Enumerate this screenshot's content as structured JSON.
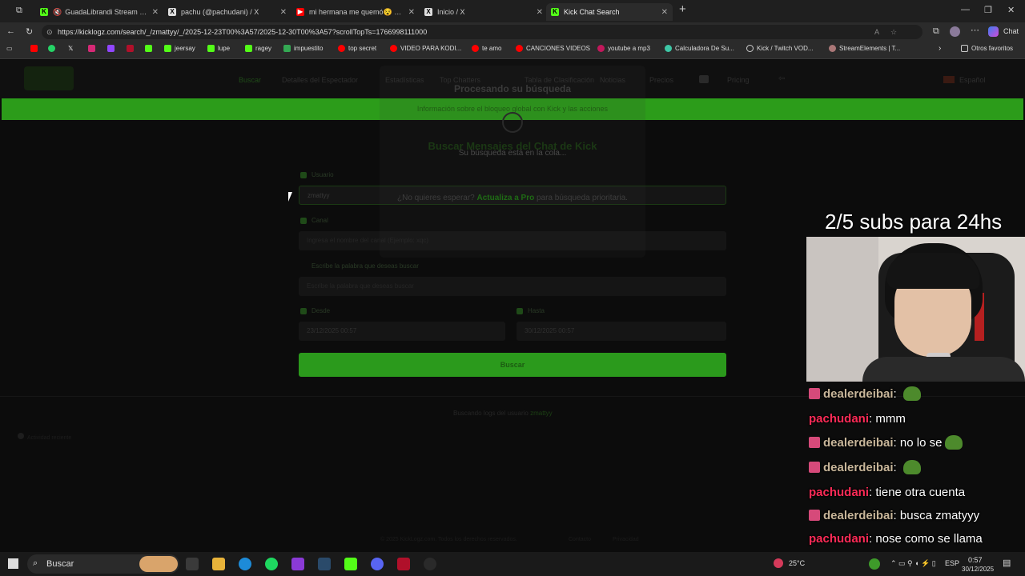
{
  "browser": {
    "tabs": [
      {
        "title": "GuadaLibrandi Stream - Watc",
        "color": "#53fc18",
        "glyph": "K"
      },
      {
        "title": "pachu (@pachudani) / X",
        "color": "#ffffff",
        "glyph": "X"
      },
      {
        "title": "mi hermana me quemó😵 - You",
        "color": "#ff0000",
        "glyph": "▶"
      },
      {
        "title": "Inicio / X",
        "color": "#ffffff",
        "glyph": "X"
      },
      {
        "title": "Kick Chat Search",
        "color": "#53fc18",
        "glyph": "K"
      }
    ],
    "url": "https://kicklogz.com/search/_/zmattyy/_/2025-12-23T00%3A57/2025-12-30T00%3A57?scrollTopTs=1766998111000",
    "chat_label": "Chat",
    "bookmarks": [
      "jeersay",
      "lupe",
      "ragey",
      "impuestito",
      "top secret",
      "VIDEO PARA KODI...",
      "te amo",
      "CANCIONES VIDEOS",
      "youtube a mp3",
      "Calculadora De Su...",
      "Kick / Twitch VOD...",
      "StreamElements | T..."
    ],
    "other_favorites": "Otros favoritos"
  },
  "page": {
    "nav": [
      "Buscar",
      "Detalles del Espectador",
      "Estadísticas",
      "Top Chatters",
      "Tabla de Clasificación",
      "Noticias",
      "Precios",
      "Pricing",
      "Español"
    ],
    "banner": "Información sobre el bloqueo global con Kick y las acciones",
    "heading": "Buscar Mensajes del Chat de Kick",
    "labels": {
      "user": "Usuario",
      "channel": "Canal",
      "word": "Escribe la palabra que deseas buscar",
      "from": "Desde",
      "to": "Hasta"
    },
    "user_value": "zmattyy",
    "channel_placeholder": "Ingresa el nombre del canal (Ejemplo: xqc)",
    "word_placeholder": "Escribe la palabra que deseas buscar",
    "from_value": "23/12/2025 00:57",
    "to_value": "30/12/2025 00:57",
    "search_button": "Buscar",
    "footer_recent": "Buscando logs del usuario",
    "footer_user": "zmattyy",
    "footer_sidebar": "Actividad reciente",
    "copyright": "© 2025 KickLogz.com. Todos los derechos reservados.",
    "footer_links": [
      "Contacto",
      "Privacidad"
    ]
  },
  "modal": {
    "title": "Procesando su búsqueda",
    "queue": "Su búsqueda está en la cola...",
    "upgrade_prefix": "¿No quieres esperar?",
    "upgrade_link": "Actualiza a Pro",
    "upgrade_suffix": "para búsqueda prioritaria."
  },
  "stream": {
    "overlay_title": "2/5 subs para 24hs",
    "chat": [
      {
        "user": "dealerdeibai",
        "kind": "sub",
        "text": "",
        "emote": true
      },
      {
        "user": "pachudani",
        "kind": "plain",
        "text": "mmm",
        "emote": false
      },
      {
        "user": "dealerdeibai",
        "kind": "sub",
        "text": "no lo se",
        "emote": true
      },
      {
        "user": "dealerdeibai",
        "kind": "sub",
        "text": "",
        "emote": true
      },
      {
        "user": "pachudani",
        "kind": "plain",
        "text": "tiene otra cuenta",
        "emote": false
      },
      {
        "user": "dealerdeibai",
        "kind": "sub",
        "text": "busca zmatyyy",
        "emote": false
      },
      {
        "user": "pachudani",
        "kind": "plain",
        "text": "nose como se llama",
        "emote": false
      }
    ]
  },
  "taskbar": {
    "search": "Buscar",
    "weather": "25°C",
    "lang": "ESP",
    "time": "0:57",
    "date": "30/12/2025"
  }
}
